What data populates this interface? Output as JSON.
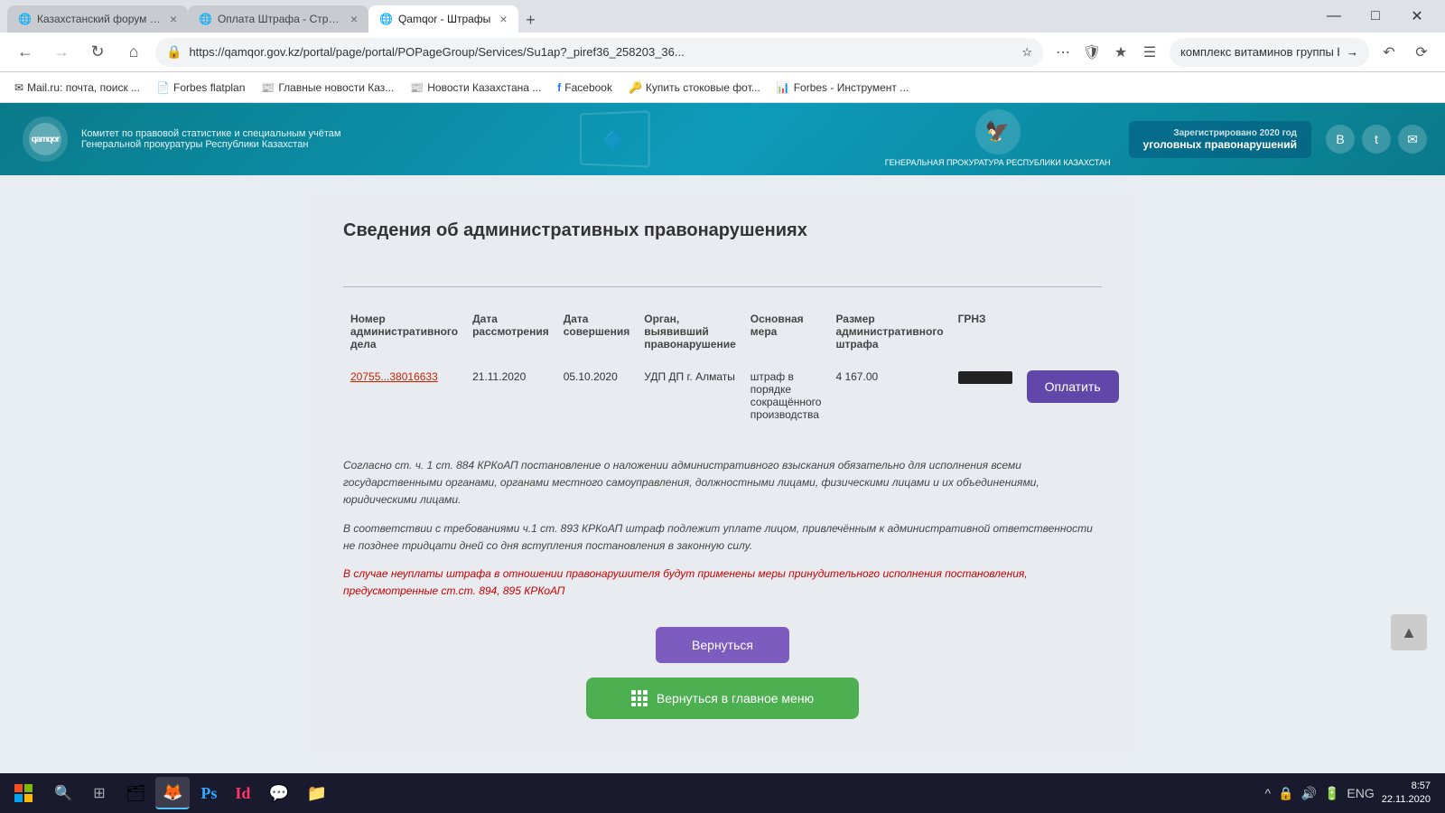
{
  "browser": {
    "tabs": [
      {
        "id": "tab1",
        "label": "Казахстанский форум «Все Б...",
        "active": false,
        "icon": "🌐"
      },
      {
        "id": "tab2",
        "label": "Оплата Штрафа - Страница ...",
        "active": false,
        "icon": "🌐"
      },
      {
        "id": "tab3",
        "label": "Qamqor - Штрафы",
        "active": true,
        "icon": "🌐"
      }
    ],
    "address": "https://qamqor.gov.kz/portal/page/portal/POPageGroup/Services/Su1ap?_piref36_258203_36...",
    "search_value": "комплекс витаминов группы b",
    "window_controls": {
      "min": "—",
      "max": "□",
      "close": "✕"
    }
  },
  "bookmarks": [
    {
      "label": "Mail.ru: почта, поиск ...",
      "icon": "✉"
    },
    {
      "label": "Forbes flatplan",
      "icon": "📄"
    },
    {
      "label": "Главные новости Каз...",
      "icon": "📰"
    },
    {
      "label": "Новости Казахстана ...",
      "icon": "📰"
    },
    {
      "label": "Facebook",
      "icon": "f"
    },
    {
      "label": "Купить стоковые фот...",
      "icon": "🔑"
    },
    {
      "label": "Forbes - Инструмент ...",
      "icon": "📊"
    }
  ],
  "header": {
    "logo": "qamqor",
    "subtitle_line1": "Комитет по правовой статистике и специальным учётам",
    "subtitle_line2": "Генеральной прокуратуры Республики Казахстан",
    "emblem_text": "ГЕНЕРАЛЬНАЯ ПРОКУРАТУРА\nРЕСПУБЛИКИ КАЗАХСТАН",
    "badge_text": "уголовных правонарушений"
  },
  "page": {
    "title": "Сведения об административных правонарушениях",
    "table": {
      "headers": [
        "Номер административного дела",
        "Дата рассмотрения",
        "Дата совершения",
        "Орган, выявивший правонарушение",
        "Основная мера",
        "Размер административного штрафа",
        "ГРНЗ"
      ],
      "row": {
        "case_number": "20755...38016633",
        "date_review": "21.11.2020",
        "date_commit": "05.10.2020",
        "organ": "УДП ДП г. Алматы",
        "measure": "штраф в порядке сокращённого производства",
        "fine_size": "4 167.00",
        "grnz": "redacted",
        "pay_btn": "Оплатить"
      }
    },
    "legal_text1": "Согласно ст. ч. 1 ст. 884 КРКоАП постановление о наложении административного взыскания обязательно для исполнения всеми государственными органами, органами местного самоуправления, должностными лицами, физическими лицами и их объединениями, юридическими лицами.",
    "legal_text2": "В соответствии с требованиями ч.1 ст. 893 КРКоАП штраф подлежит уплате лицом, привлечённым к административной ответственности не позднее тридцати дней со дня вступления постановления в законную силу.",
    "legal_warning": "В случае неуплаты штрафа в отношении правонарушителя будут применены меры принудительного исполнения постановления, предусмотренные ст.ст. 894, 895 КРКоАП",
    "back_btn": "Вернуться",
    "main_menu_btn": "Вернуться в главное меню"
  },
  "taskbar": {
    "apps": [
      {
        "icon": "⊞",
        "label": "Start",
        "type": "start"
      },
      {
        "icon": "🔍",
        "label": "Search"
      },
      {
        "icon": "⊞",
        "label": "Task View"
      },
      {
        "icon": "🗂",
        "label": "File Explorer",
        "active": false
      },
      {
        "icon": "🦊",
        "label": "Firefox",
        "active": true
      },
      {
        "icon": "🎨",
        "label": "Photoshop",
        "active": false
      },
      {
        "icon": "📝",
        "label": "InDesign",
        "active": false
      },
      {
        "icon": "💬",
        "label": "Skype",
        "active": false
      },
      {
        "icon": "📁",
        "label": "Explorer2",
        "active": false
      }
    ],
    "tray": {
      "lang": "ENG",
      "time": "8:57",
      "date": "22.11.2020"
    }
  }
}
